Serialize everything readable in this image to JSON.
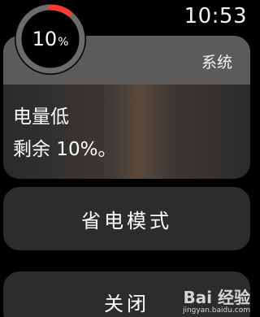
{
  "status_bar": {
    "time": "10:53"
  },
  "battery": {
    "percent": 10,
    "value_text": "10",
    "unit_text": "%",
    "ring_color": "#ff3b30",
    "track_color": "#6b6b6b"
  },
  "notification": {
    "app_name": "系统",
    "title": "电量低",
    "message": "剩余 10%。"
  },
  "buttons": {
    "power_reserve_label": "省电模式",
    "close_label": "关闭"
  },
  "watermark": {
    "main": "Bai 经验",
    "sub": "jingyan.baidu.com"
  }
}
